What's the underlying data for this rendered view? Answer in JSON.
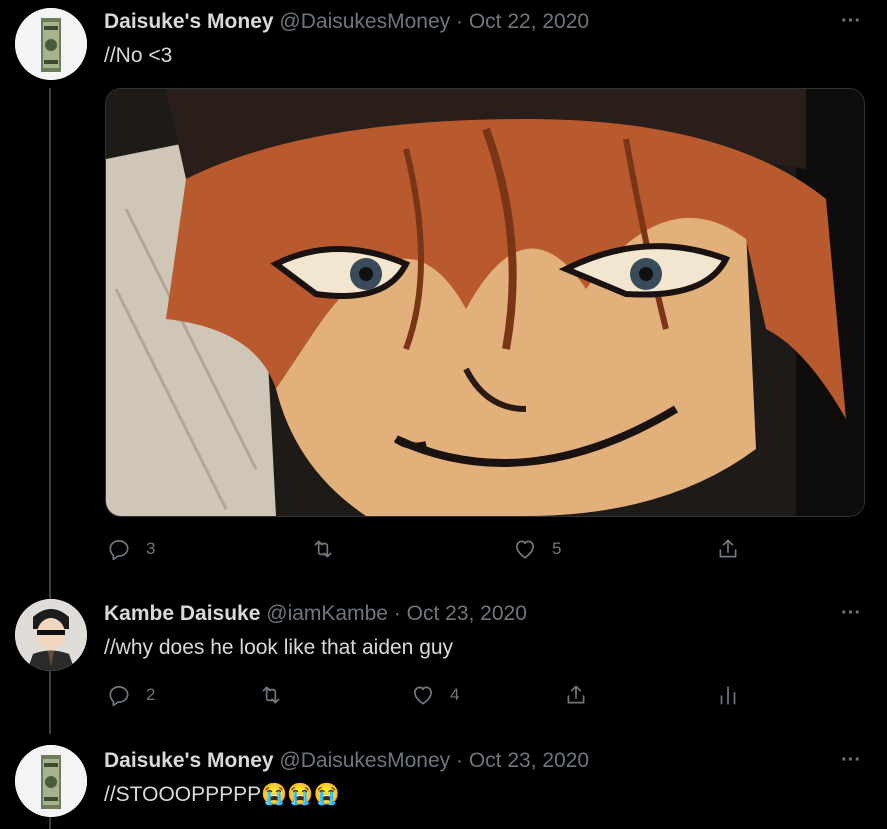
{
  "tweets": [
    {
      "name": "Daisuke's Money",
      "handle": "@DaisukesMoney",
      "separator": "·",
      "date": "Oct 22, 2020",
      "text": "//No <3",
      "replies": "3",
      "retweets": "",
      "likes": "5"
    },
    {
      "name": "Kambe Daisuke",
      "handle": "@iamKambe",
      "separator": "·",
      "date": "Oct 23, 2020",
      "text": "//why does he look like that aiden guy",
      "replies": "2",
      "retweets": "",
      "likes": "4"
    },
    {
      "name": "Daisuke's Money",
      "handle": "@DaisukesMoney",
      "separator": "·",
      "date": "Oct 23, 2020",
      "text": "//STOOOPPPPP😭😭😭"
    }
  ],
  "more_glyph": "···",
  "colors": {
    "background": "#000000",
    "text_primary": "#d9d9d9",
    "text_secondary": "#6e767d",
    "thread_line": "#3d4145"
  }
}
